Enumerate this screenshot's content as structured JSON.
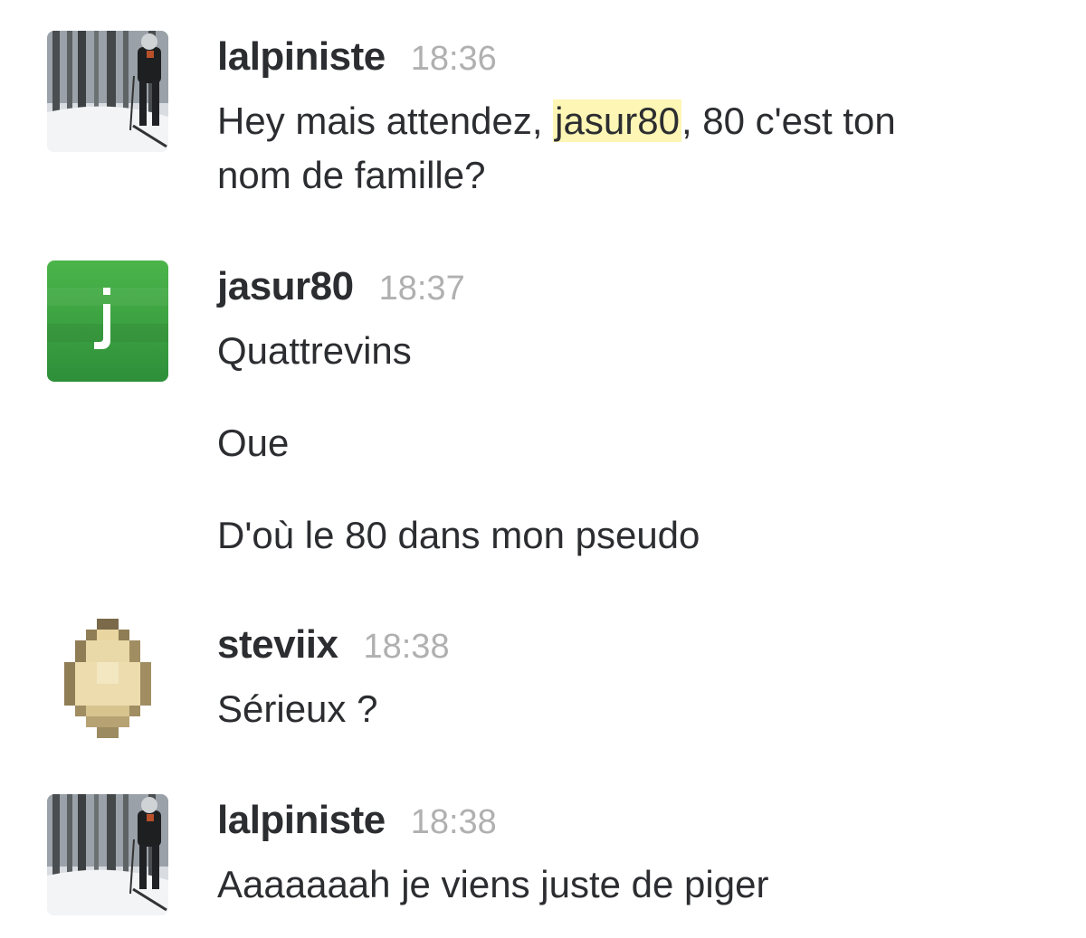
{
  "colors": {
    "text": "#2c2d30",
    "timestamp": "#b0b0b0",
    "mention_highlight": "#fdf6b4",
    "jasur_avatar_green": "#3da63f"
  },
  "messages": [
    {
      "username": "lalpiniste",
      "time": "18:36",
      "avatar": "snowy-forest-skier-photo",
      "lines": [
        {
          "before": "Hey mais attendez, ",
          "mention": "jasur80",
          "after": ", 80 c'est ton"
        },
        {
          "text": "nom de famille?"
        }
      ]
    },
    {
      "username": "jasur80",
      "time": "18:37",
      "avatar": "green-letter-j",
      "avatar_letter": "j",
      "lines": [
        {
          "text": "Quattrevins"
        },
        {
          "text": "Oue"
        },
        {
          "text": "D'où le 80 dans mon pseudo"
        }
      ]
    },
    {
      "username": "steviix",
      "time": "18:38",
      "avatar": "pixel-egg",
      "lines": [
        {
          "text": "Sérieux ?"
        }
      ]
    },
    {
      "username": "lalpiniste",
      "time": "18:38",
      "avatar": "snowy-forest-skier-photo",
      "lines": [
        {
          "text": "Aaaaaaah je viens juste de piger"
        }
      ]
    }
  ]
}
